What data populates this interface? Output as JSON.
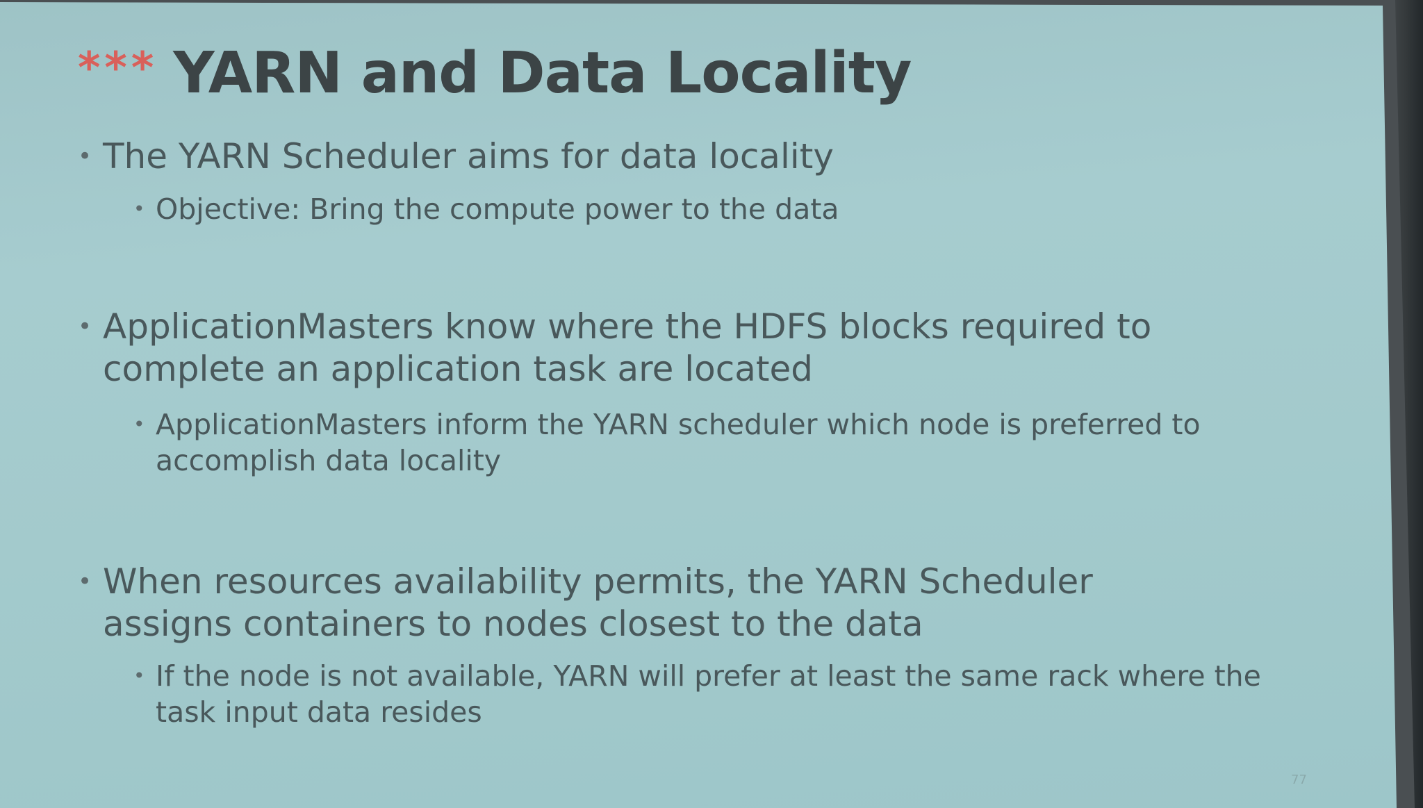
{
  "slide": {
    "title_marker": "***",
    "title": "YARN and Data Locality",
    "bullets": [
      {
        "text": "The YARN Scheduler aims for data locality",
        "sub": [
          "Objective: Bring the compute power to the data"
        ]
      },
      {
        "text": "ApplicationMasters know where the HDFS blocks required to complete an application task are located",
        "sub": [
          "ApplicationMasters inform the YARN scheduler which node is preferred to accomplish data locality"
        ]
      },
      {
        "text": "When resources availability permits, the YARN Scheduler assigns containers to nodes closest to the data",
        "sub": [
          "If the node is not available, YARN will prefer at least the same rack where the task input data resides"
        ]
      }
    ],
    "page_number": "77"
  },
  "colors": {
    "background": "#a6cccf",
    "title": "#3c4446",
    "stars": "#d9605a",
    "body_text": "#49585b"
  }
}
